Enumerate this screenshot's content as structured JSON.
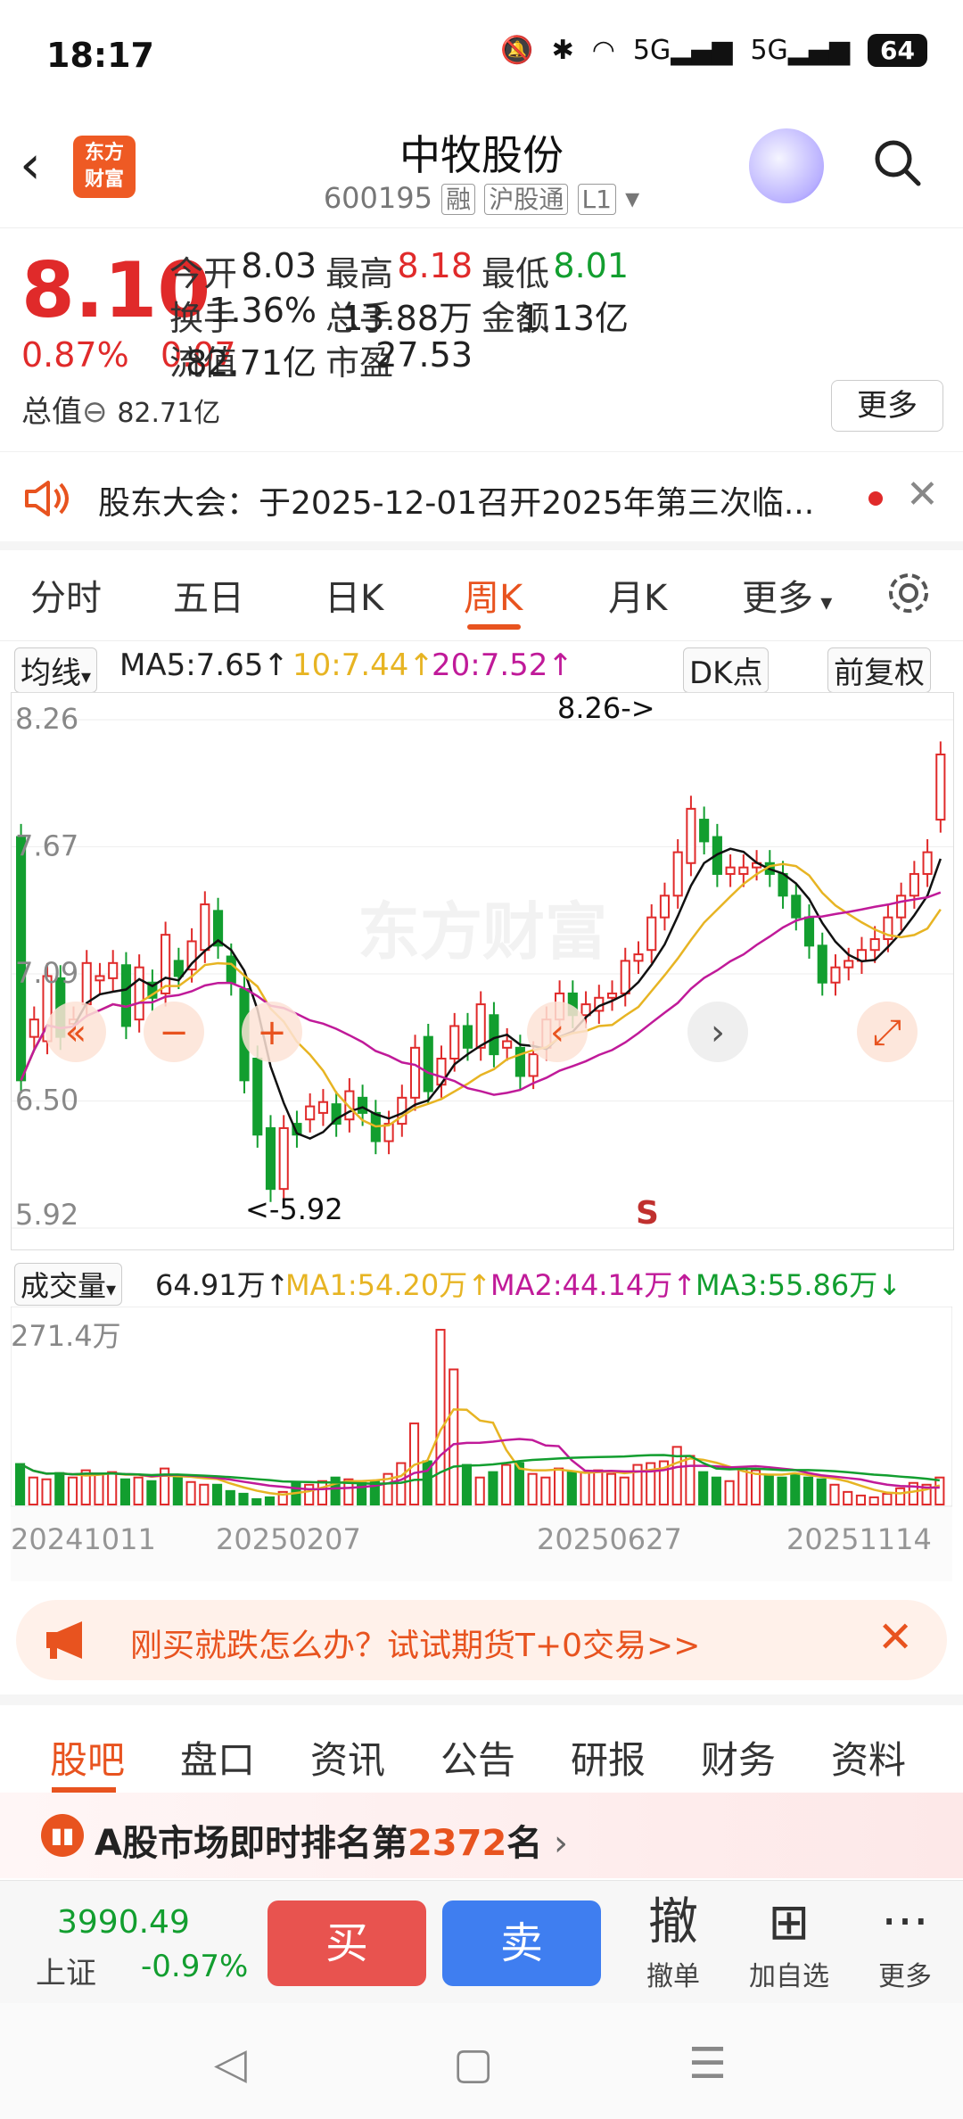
{
  "status": {
    "time": "18:17",
    "battery": "64"
  },
  "header": {
    "title": "中牧股份",
    "code": "600195",
    "tags": [
      "融",
      "沪股通",
      "L1"
    ],
    "logo_text": "东方\n财富"
  },
  "quote": {
    "price": "8.10",
    "pct": "0.87%",
    "change": "0.07",
    "rows": [
      [
        {
          "label": "今开",
          "value": "8.03",
          "color": "#222"
        },
        {
          "label": "最高",
          "value": "8.18",
          "color": "#e02a2a"
        },
        {
          "label": "最低",
          "value": "8.01",
          "color": "#129e2f"
        }
      ],
      [
        {
          "label": "换手",
          "value": "1.36%",
          "color": "#222"
        },
        {
          "label": "总手",
          "value": "13.88万",
          "color": "#222"
        },
        {
          "label": "金额",
          "value": "1.13亿",
          "color": "#222"
        }
      ],
      [
        {
          "label": "流值",
          "value": "82.71亿",
          "color": "#222"
        },
        {
          "label": "市盈",
          "value": "27.53",
          "color": "#222"
        }
      ]
    ],
    "total_label": "总值",
    "total_value": "82.71亿",
    "more": "更多"
  },
  "notice": {
    "text": "股东大会：于2025-12-01召开2025年第三次临..."
  },
  "tabs": {
    "items": [
      "分时",
      "五日",
      "日K",
      "周K",
      "月K",
      "更多"
    ],
    "active": "周K"
  },
  "ma": {
    "mode": "均线",
    "ma5": "MA5:7.65",
    "ma10": "10:7.44",
    "ma20": "20:7.52",
    "dk": "DK点",
    "adjust": "前复权"
  },
  "chart_data": {
    "type": "candlestick",
    "y_labels": [
      "8.26",
      "7.67",
      "7.09",
      "6.50",
      "5.92"
    ],
    "ylim": [
      5.92,
      8.26
    ],
    "marks": {
      "high": "8.26->",
      "low": "<-5.92"
    },
    "signal": "S",
    "candles": [
      [
        7.72,
        6.6
      ],
      [
        6.8,
        6.88
      ],
      [
        6.78,
        7.08
      ],
      [
        7.07,
        6.8
      ],
      [
        6.86,
        6.88
      ],
      [
        6.95,
        7.14
      ],
      [
        7.06,
        7.08
      ],
      [
        7.07,
        7.14
      ],
      [
        7.13,
        6.85
      ],
      [
        6.88,
        7.12
      ],
      [
        7.05,
        6.98
      ],
      [
        7.0,
        7.27
      ],
      [
        7.15,
        7.08
      ],
      [
        7.11,
        7.24
      ],
      [
        7.2,
        7.41
      ],
      [
        7.38,
        7.22
      ],
      [
        7.17,
        7.05
      ],
      [
        7.02,
        6.6
      ],
      [
        6.7,
        6.35
      ],
      [
        6.38,
        6.1
      ],
      [
        6.1,
        6.38
      ],
      [
        6.4,
        6.35
      ],
      [
        6.42,
        6.48
      ],
      [
        6.45,
        6.5
      ],
      [
        6.49,
        6.4
      ],
      [
        6.42,
        6.55
      ],
      [
        6.52,
        6.45
      ],
      [
        6.45,
        6.32
      ],
      [
        6.32,
        6.4
      ],
      [
        6.4,
        6.52
      ],
      [
        6.52,
        6.75
      ],
      [
        6.8,
        6.55
      ],
      [
        6.58,
        6.7
      ],
      [
        6.7,
        6.85
      ],
      [
        6.85,
        6.75
      ],
      [
        6.75,
        6.95
      ],
      [
        6.9,
        6.72
      ],
      [
        6.75,
        6.78
      ],
      [
        6.75,
        6.62
      ],
      [
        6.62,
        6.72
      ],
      [
        6.75,
        6.88
      ],
      [
        6.88,
        7.0
      ],
      [
        7.0,
        6.9
      ],
      [
        6.9,
        6.95
      ],
      [
        6.92,
        6.98
      ],
      [
        6.98,
        7.0
      ],
      [
        7.0,
        7.15
      ],
      [
        7.15,
        7.18
      ],
      [
        7.2,
        7.35
      ],
      [
        7.35,
        7.45
      ],
      [
        7.45,
        7.65
      ],
      [
        7.6,
        7.85
      ],
      [
        7.8,
        7.7
      ],
      [
        7.72,
        7.55
      ],
      [
        7.55,
        7.58
      ],
      [
        7.55,
        7.58
      ],
      [
        7.58,
        7.6
      ],
      [
        7.6,
        7.55
      ],
      [
        7.55,
        7.45
      ],
      [
        7.45,
        7.35
      ],
      [
        7.35,
        7.22
      ],
      [
        7.22,
        7.05
      ],
      [
        7.05,
        7.12
      ],
      [
        7.12,
        7.15
      ],
      [
        7.15,
        7.2
      ],
      [
        7.2,
        7.25
      ],
      [
        7.25,
        7.35
      ],
      [
        7.35,
        7.45
      ],
      [
        7.45,
        7.55
      ],
      [
        7.55,
        7.65
      ],
      [
        7.8,
        8.1
      ]
    ],
    "volume_label": "成交量",
    "volume_max": "271.4万",
    "volume_ma": {
      "v": "64.91万",
      "ma1": "MA1:54.20万",
      "ma2": "MA2:44.14万",
      "ma3": "MA3:55.86万"
    },
    "dates": [
      "20241011",
      "20250207",
      "20250627",
      "20251114"
    ]
  },
  "ad": {
    "text": "刚买就跌怎么办？试试期货T+0交易>>"
  },
  "btabs": {
    "items": [
      "股吧",
      "盘口",
      "资讯",
      "公告",
      "研报",
      "财务",
      "资料"
    ],
    "active": "股吧"
  },
  "rank": {
    "prefix": "A股市场即时排名第",
    "number": "2372",
    "suffix": "名"
  },
  "bottom": {
    "index_value": "3990.49",
    "index_name": "上证",
    "index_pct": "-0.97%",
    "buy": "买",
    "sell": "卖",
    "tools": [
      {
        "icon": "撤",
        "label": "撤单"
      },
      {
        "icon": "⊞",
        "label": "加自选"
      },
      {
        "icon": "···",
        "label": "更多"
      }
    ]
  },
  "nav": {
    "back": "◁",
    "home": "▢",
    "menu": "☰"
  },
  "colors": {
    "up": "#e02a2a",
    "down": "#129e2f",
    "accent": "#e8531f",
    "ma5": "#111",
    "ma10": "#e7b423",
    "ma20": "#c01a99"
  }
}
